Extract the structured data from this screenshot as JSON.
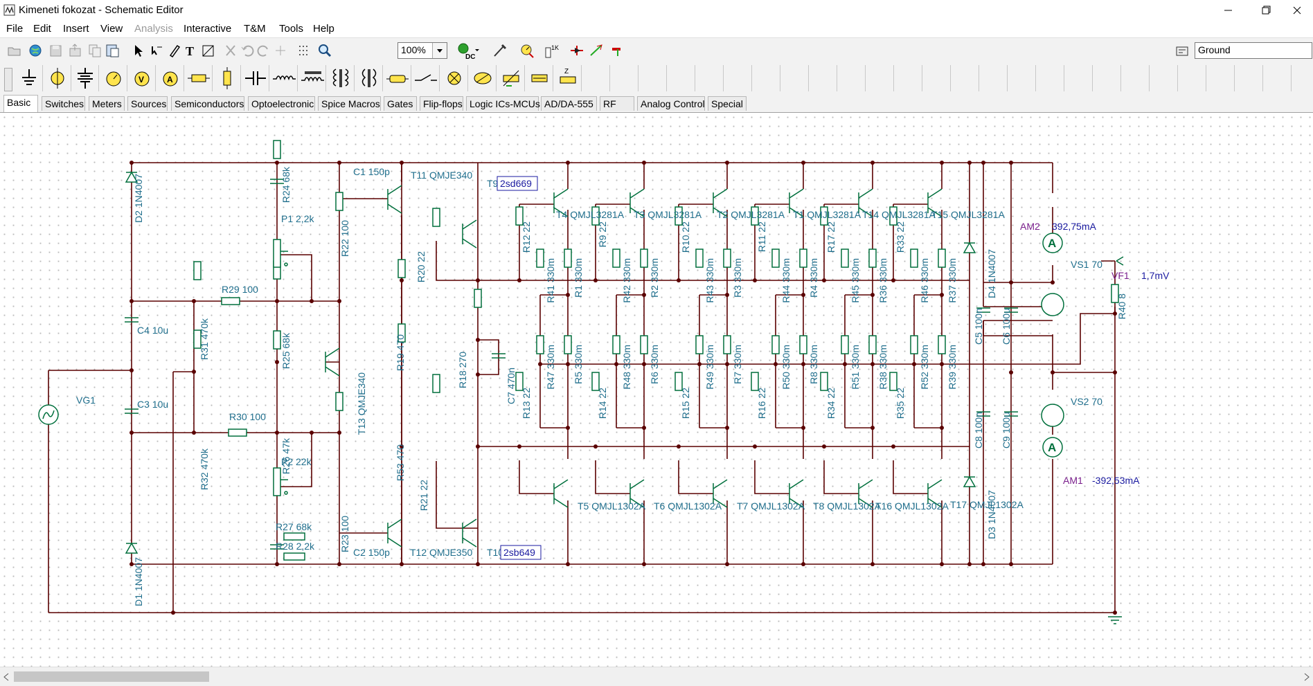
{
  "window": {
    "title": "Kimeneti fokozat - Schematic Editor"
  },
  "menu": [
    "File",
    "Edit",
    "Insert",
    "View",
    "Analysis",
    "Interactive",
    "T&M",
    "Tools",
    "Help"
  ],
  "menu_disabled": [
    "Analysis"
  ],
  "toolbar": {
    "zoom": "100%",
    "component_select": "Ground"
  },
  "tabs": [
    "Basic",
    "Switches",
    "Meters",
    "Sources",
    "Semiconductors",
    "Optoelectronic",
    "Spice Macros",
    "Gates",
    "Flip-flops",
    "Logic ICs-MCUs",
    "AD/DA-555",
    "RF",
    "Analog Control",
    "Special"
  ],
  "active_tab": "Basic",
  "schematic": {
    "labels": [
      {
        "text": "D2 1N4007",
        "vertical": true
      },
      {
        "text": "R24 68k",
        "vertical": true
      },
      {
        "text": "C1 150p",
        "vertical": false
      },
      {
        "text": "T11 QMJE340",
        "vertical": false
      },
      {
        "text": "T9",
        "vertical": false
      },
      {
        "text": "2sd669",
        "vertical": false
      },
      {
        "text": "P1 2,2k",
        "vertical": false
      },
      {
        "text": "R22 100",
        "vertical": true
      },
      {
        "text": "R20 22",
        "vertical": true
      },
      {
        "text": "R29 100",
        "vertical": false
      },
      {
        "text": "C4 10u",
        "vertical": false
      },
      {
        "text": "R31 470k",
        "vertical": true
      },
      {
        "text": "R25 68k",
        "vertical": true
      },
      {
        "text": "R19 470",
        "vertical": true
      },
      {
        "text": "R18 270",
        "vertical": true
      },
      {
        "text": "C7 470n",
        "vertical": true
      },
      {
        "text": "T13 QMJE340",
        "vertical": true
      },
      {
        "text": "VG1",
        "vertical": false
      },
      {
        "text": "C3 10u",
        "vertical": false
      },
      {
        "text": "R32 470k",
        "vertical": true
      },
      {
        "text": "R30 100",
        "vertical": false
      },
      {
        "text": "R26 47k",
        "vertical": true
      },
      {
        "text": "R53 470",
        "vertical": true
      },
      {
        "text": "P2 22k",
        "vertical": false
      },
      {
        "text": "R21 22",
        "vertical": true
      },
      {
        "text": "R23 100",
        "vertical": true
      },
      {
        "text": "R27 68k",
        "vertical": false
      },
      {
        "text": "R28 2,2k",
        "vertical": false
      },
      {
        "text": "D1 1N4007",
        "vertical": true
      },
      {
        "text": "C2 150p",
        "vertical": false
      },
      {
        "text": "T12 QMJE350",
        "vertical": false
      },
      {
        "text": "T10",
        "vertical": false
      },
      {
        "text": "2sb649",
        "vertical": false
      },
      {
        "text": "T4 QMJL3281A",
        "vertical": false
      },
      {
        "text": "T3 QMJL3281A",
        "vertical": false
      },
      {
        "text": "T2 QMJL3281A",
        "vertical": false
      },
      {
        "text": "T1 QMJL3281A",
        "vertical": false
      },
      {
        "text": "T14 QMJL3281A",
        "vertical": false
      },
      {
        "text": "T15 QMJL3281A",
        "vertical": false
      },
      {
        "text": "R12 22",
        "vertical": true
      },
      {
        "text": "R9 22",
        "vertical": true
      },
      {
        "text": "R10 22",
        "vertical": true
      },
      {
        "text": "R11 22",
        "vertical": true
      },
      {
        "text": "R17 22",
        "vertical": true
      },
      {
        "text": "R33 22",
        "vertical": true
      },
      {
        "text": "R41 330m",
        "vertical": true
      },
      {
        "text": "R1 330m",
        "vertical": true
      },
      {
        "text": "R42 330m",
        "vertical": true
      },
      {
        "text": "R2 330m",
        "vertical": true
      },
      {
        "text": "R43 330m",
        "vertical": true
      },
      {
        "text": "R3 330m",
        "vertical": true
      },
      {
        "text": "R44 330m",
        "vertical": true
      },
      {
        "text": "R4 330m",
        "vertical": true
      },
      {
        "text": "R45 330m",
        "vertical": true
      },
      {
        "text": "R36 330m",
        "vertical": true
      },
      {
        "text": "R46 330m",
        "vertical": true
      },
      {
        "text": "R37 330m",
        "vertical": true
      },
      {
        "text": "R47 330m",
        "vertical": true
      },
      {
        "text": "R5 330m",
        "vertical": true
      },
      {
        "text": "R48 330m",
        "vertical": true
      },
      {
        "text": "R6 330m",
        "vertical": true
      },
      {
        "text": "R49 330m",
        "vertical": true
      },
      {
        "text": "R7 330m",
        "vertical": true
      },
      {
        "text": "R50 330m",
        "vertical": true
      },
      {
        "text": "R8 330m",
        "vertical": true
      },
      {
        "text": "R51 330m",
        "vertical": true
      },
      {
        "text": "R38 330m",
        "vertical": true
      },
      {
        "text": "R52 330m",
        "vertical": true
      },
      {
        "text": "R39 330m",
        "vertical": true
      },
      {
        "text": "R13 22",
        "vertical": true
      },
      {
        "text": "R14 22",
        "vertical": true
      },
      {
        "text": "R15 22",
        "vertical": true
      },
      {
        "text": "R16 22",
        "vertical": true
      },
      {
        "text": "R34 22",
        "vertical": true
      },
      {
        "text": "R35 22",
        "vertical": true
      },
      {
        "text": "T5 QMJL1302A",
        "vertical": false
      },
      {
        "text": "T6 QMJL1302A",
        "vertical": false
      },
      {
        "text": "T7 QMJL1302A",
        "vertical": false
      },
      {
        "text": "T8 QMJL1302A",
        "vertical": false
      },
      {
        "text": "T16 QMJL1302A",
        "vertical": false
      },
      {
        "text": "T17 QMJL1302A",
        "vertical": false
      },
      {
        "text": "D4 1N4007",
        "vertical": true
      },
      {
        "text": "D3 1N4007",
        "vertical": true
      },
      {
        "text": "C5 100n",
        "vertical": true
      },
      {
        "text": "C6 100u",
        "vertical": true
      },
      {
        "text": "C8 100n",
        "vertical": true
      },
      {
        "text": "C9 100u",
        "vertical": true
      },
      {
        "text": "AM2",
        "vertical": false
      },
      {
        "text": "392,75mA",
        "vertical": false
      },
      {
        "text": "VS1 70",
        "vertical": false
      },
      {
        "text": "VF1",
        "vertical": false
      },
      {
        "text": "1,7mV",
        "vertical": false
      },
      {
        "text": "R40 8",
        "vertical": true
      },
      {
        "text": "VS2 70",
        "vertical": false
      },
      {
        "text": "AM1",
        "vertical": false
      },
      {
        "text": "-392,53mA",
        "vertical": false
      }
    ]
  },
  "colors": {
    "wire": "#5a0000",
    "component": "#006f3c",
    "label": "#1f6e8c",
    "meter_label": "#7a1f8c",
    "meter_value": "#1a1aa0"
  }
}
